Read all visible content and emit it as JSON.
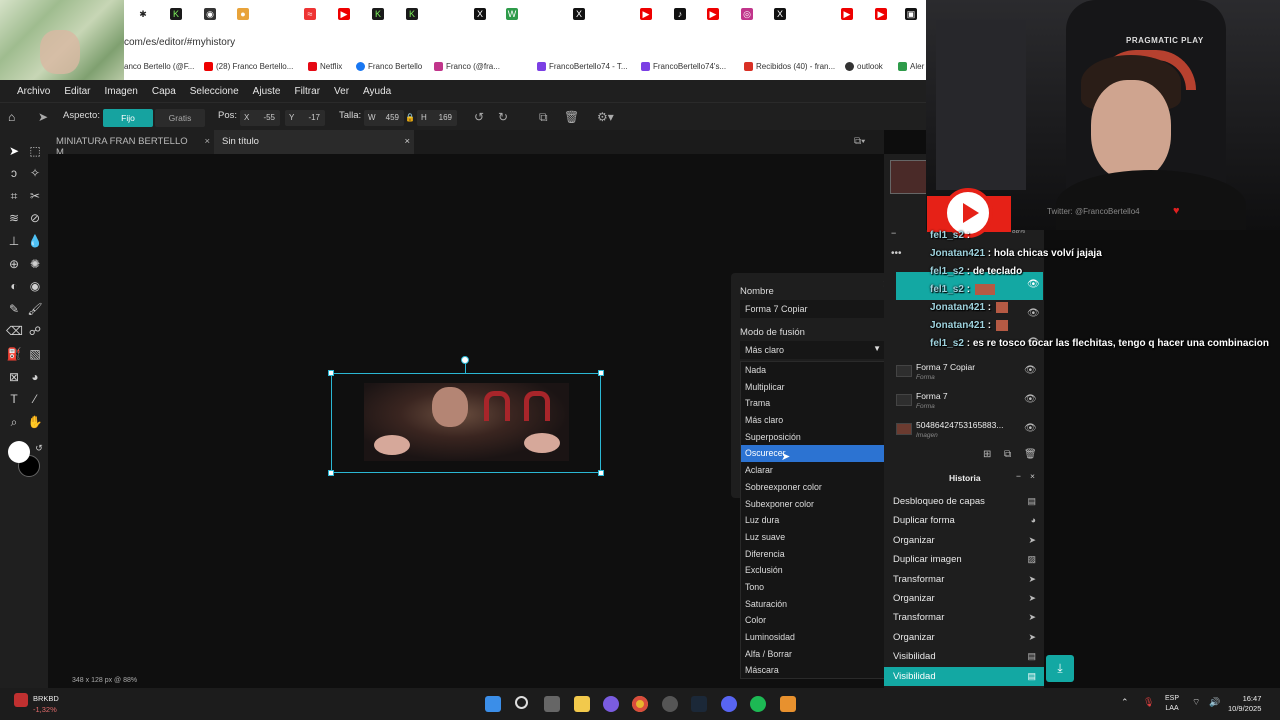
{
  "browser": {
    "address": "com/es/editor/#myhistory",
    "bookmarks": [
      "anco Bertello (@F...",
      "(28) Franco Bertello...",
      "Netflix",
      "Franco Bertello",
      "Franco (@fra...",
      "FrancoBertello74 - T...",
      "FrancoBertello74's...",
      "Recibidos (40) - fran...",
      "outlook",
      "Aler"
    ]
  },
  "menu": [
    "Archivo",
    "Editar",
    "Imagen",
    "Capa",
    "Seleccione",
    "Ajuste",
    "Filtrar",
    "Ver",
    "Ayuda"
  ],
  "tool_options": {
    "aspect_label": "Aspecto:",
    "fixed": "Fijo",
    "free": "Gratis",
    "pos_label": "Pos:",
    "x_label": "X",
    "x_value": "-55",
    "y_label": "Y",
    "y_value": "-17",
    "size_label": "Talla:",
    "w_label": "W",
    "w_value": "459",
    "h_label": "H",
    "h_value": "169"
  },
  "doc_tabs": [
    {
      "label": "MINIATURA FRAN BERTELLO M..."
    },
    {
      "label": "Sin título"
    }
  ],
  "status": "348 x 128 px @ 88%",
  "layer_props": {
    "name_label": "Nombre",
    "name_value": "Forma 7 Copiar",
    "blend_label": "Modo de fusión",
    "blend_value": "Más claro",
    "blend_options": [
      "Nada",
      "Multiplicar",
      "Trama",
      "Más claro",
      "Superposición",
      "Oscurecer",
      "Aclarar",
      "Sobreexponer color",
      "Subexponer color",
      "Luz dura",
      "Luz suave",
      "Diferencia",
      "Exclusión",
      "Tono",
      "Saturación",
      "Color",
      "Luminosidad",
      "Alfa / Borrar",
      "Máscara"
    ],
    "blend_highlighted": "Oscurecer"
  },
  "layers": [
    {
      "name": "Forma 7 Copiar",
      "type": "Forma"
    },
    {
      "name": "Forma 7",
      "type": "Forma"
    },
    {
      "name": "50486424753165883...",
      "type": "Imagen"
    }
  ],
  "zoom_small": "88%",
  "history": {
    "title": "Historia",
    "items": [
      "Desbloqueo de capas",
      "Duplicar forma",
      "Organizar",
      "Duplicar imagen",
      "Transformar",
      "Organizar",
      "Transformar",
      "Organizar",
      "Visibilidad",
      "Visibilidad"
    ]
  },
  "stream": {
    "brand": "PRAGMATIC PLAY",
    "twitter": "Twitter: @FrancoBertello4",
    "chat": [
      {
        "user": "fel1_s2",
        "msg": ""
      },
      {
        "user": "Jonatan421",
        "msg": "hola chicas volví jajaja"
      },
      {
        "user": "fel1_s2",
        "msg": "de teclado"
      },
      {
        "user": "fel1_s2",
        "msg": ""
      },
      {
        "user": "Jonatan421",
        "msg": ""
      },
      {
        "user": "Jonatan421",
        "msg": ""
      },
      {
        "user": "fel1_s2",
        "msg": "es re tosco tocar las flechitas, tengo q hacer una combinacion"
      }
    ]
  },
  "taskbar": {
    "ticker": "BRKBD",
    "change": "-1,32%",
    "lang1": "ESP",
    "lang2": "LAA",
    "time": "16:47",
    "date": "10/9/2025"
  }
}
